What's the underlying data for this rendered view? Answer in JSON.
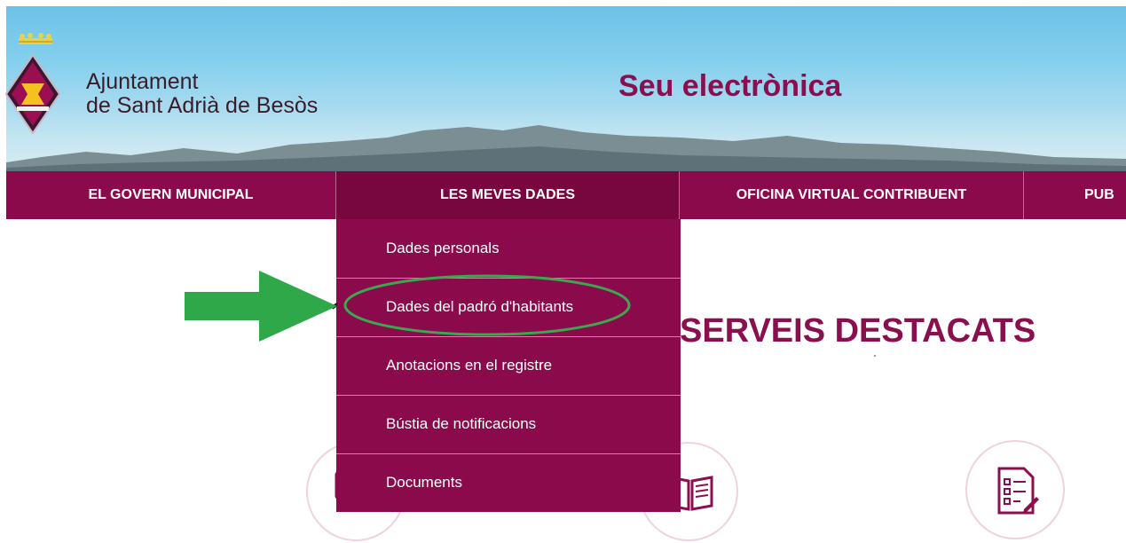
{
  "header": {
    "org_line1": "Ajuntament",
    "org_line2": "de Sant Adrià de Besòs",
    "site_title": "Seu electrònica",
    "logo_icon": "municipal-shield-icon"
  },
  "nav": {
    "items": [
      {
        "label": "EL GOVERN MUNICIPAL"
      },
      {
        "label": "LES MEVES DADES"
      },
      {
        "label": "OFICINA VIRTUAL CONTRIBUENT"
      },
      {
        "label": "PUB"
      }
    ],
    "active": "LES MEVES DADES"
  },
  "dropdown": {
    "items": [
      {
        "label": "Dades personals"
      },
      {
        "label": "Dades del padró d'habitants"
      },
      {
        "label": "Anotacions en el registre"
      },
      {
        "label": "Bústia de notificacions"
      },
      {
        "label": "Documents"
      }
    ],
    "highlighted": "Dades del padró d'habitants"
  },
  "services": {
    "title": "SERVEIS DESTACATS",
    "icons": [
      "computer-icon",
      "open-book-icon",
      "form-checklist-icon"
    ]
  },
  "annotations": {
    "arrow": "green-arrow-icon",
    "highlight": "green-oval-highlight"
  },
  "colors": {
    "brand": "#8b0a4c",
    "brand_active": "#79073f",
    "title_text": "#8b0f4e",
    "annotation_green": "#2fa84a"
  }
}
